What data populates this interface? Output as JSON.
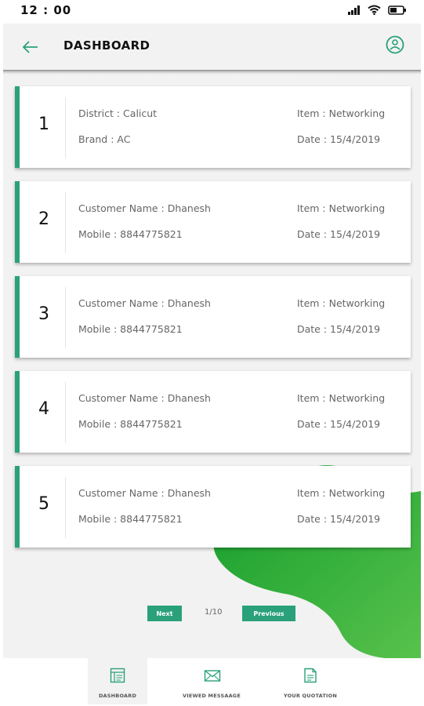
{
  "status_bar": {
    "time": "12 : 00"
  },
  "header": {
    "title": "DASHBOARD"
  },
  "cards": [
    {
      "number": "1",
      "left_top": "District : Calicut",
      "left_bottom": "Brand : AC",
      "right_top": "Item : Networking",
      "right_bottom": "Date : 15/4/2019"
    },
    {
      "number": "2",
      "left_top": "Customer Name : Dhanesh",
      "left_bottom": "Mobile : 8844775821",
      "right_top": "Item : Networking",
      "right_bottom": "Date : 15/4/2019"
    },
    {
      "number": "3",
      "left_top": "Customer Name : Dhanesh",
      "left_bottom": "Mobile : 8844775821",
      "right_top": "Item : Networking",
      "right_bottom": "Date : 15/4/2019"
    },
    {
      "number": "4",
      "left_top": "Customer Name : Dhanesh",
      "left_bottom": "Mobile : 8844775821",
      "right_top": "Item : Networking",
      "right_bottom": "Date : 15/4/2019"
    },
    {
      "number": "5",
      "left_top": "Customer Name : Dhanesh",
      "left_bottom": "Mobile : 8844775821",
      "right_top": "Item : Networking",
      "right_bottom": "Date : 15/4/2019"
    }
  ],
  "pagination": {
    "next_label": "Next",
    "page_indicator": "1/10",
    "previous_label": "Previous"
  },
  "bottom_nav": {
    "items": [
      {
        "label": "DASHBOARD",
        "icon": "dashboard-icon",
        "active": true
      },
      {
        "label": "VIEWED MESSAAGE",
        "icon": "envelope-icon",
        "active": false
      },
      {
        "label": "YOUR QUOTATION",
        "icon": "document-icon",
        "active": false
      }
    ]
  },
  "colors": {
    "accent": "#2aa17a",
    "blob_light": "#58c24c",
    "blob_dark": "#129c2c",
    "background": "#f2f2f2"
  }
}
